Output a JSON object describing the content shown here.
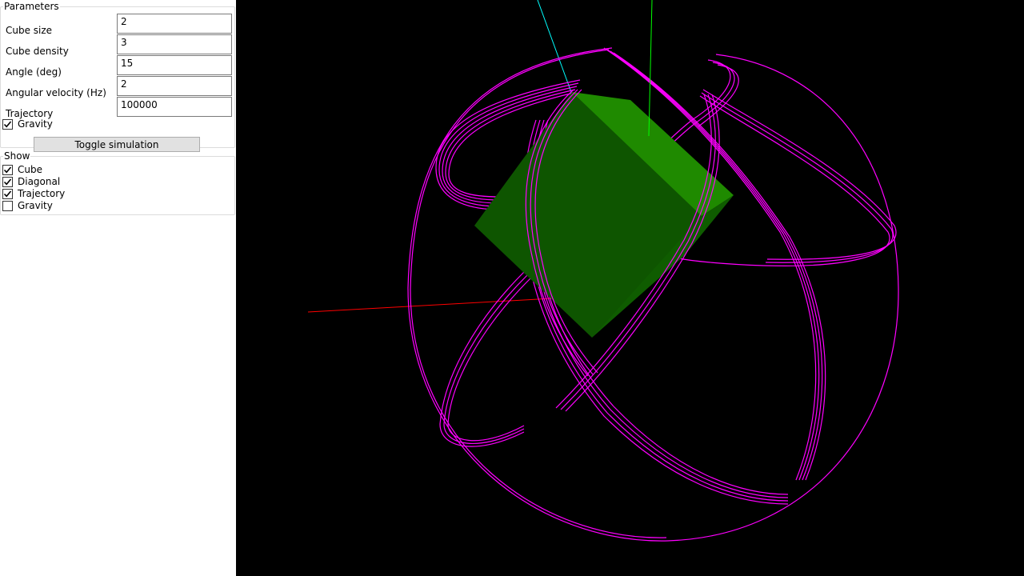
{
  "parameters": {
    "title": "Parameters",
    "fields": [
      {
        "label": "Cube size",
        "value": "2"
      },
      {
        "label": "Cube density",
        "value": "3"
      },
      {
        "label": "Angle (deg)",
        "value": "15"
      },
      {
        "label": "Angular velocity (Hz)",
        "value": "2"
      },
      {
        "label": "Trajectory",
        "value": "100000"
      }
    ],
    "gravity": {
      "label": "Gravity",
      "checked": true
    },
    "toggle_label": "Toggle simulation"
  },
  "show": {
    "title": "Show",
    "items": [
      {
        "label": "Cube",
        "checked": true
      },
      {
        "label": "Diagonal",
        "checked": true
      },
      {
        "label": "Trajectory",
        "checked": true
      },
      {
        "label": "Gravity",
        "checked": false
      }
    ]
  },
  "viewport": {
    "background": "#000000",
    "cube_color": "#1f8a00",
    "trajectory_color": "#ff00ff",
    "axis_x_color": "#ff0000",
    "axis_y_color": "#00ff00",
    "axis_z_color": "#00ffff"
  }
}
